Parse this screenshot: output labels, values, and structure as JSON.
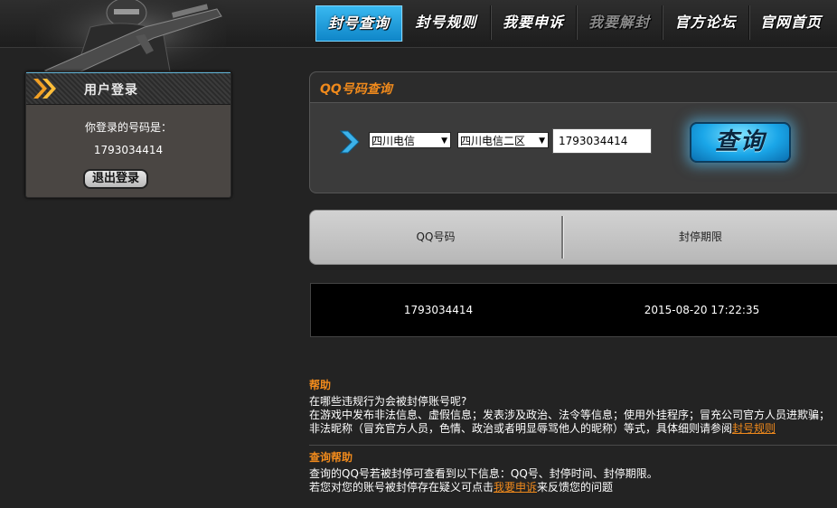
{
  "nav": {
    "items": [
      {
        "label": "封号查询",
        "state": "active"
      },
      {
        "label": "封号规则",
        "state": "normal"
      },
      {
        "label": "我要申诉",
        "state": "normal"
      },
      {
        "label": "我要解封",
        "state": "disabled"
      },
      {
        "label": "官方论坛",
        "state": "normal"
      },
      {
        "label": "官网首页",
        "state": "normal"
      }
    ]
  },
  "login": {
    "title": "用户登录",
    "label": "你登录的号码是：",
    "qq": "1793034414",
    "logout_label": "退出登录"
  },
  "query": {
    "title": "QQ号码查询",
    "isp_select": "四川电信",
    "region_select": "四川电信二区",
    "qq_value": "1793034414",
    "button_label": "查询"
  },
  "results": {
    "columns": [
      "QQ号码",
      "封停期限"
    ],
    "rows": [
      [
        "1793034414",
        "2015-08-20 17:22:35"
      ]
    ]
  },
  "help": {
    "title": "帮助",
    "question": "在哪些违规行为会被封停账号呢?",
    "line1": "在游戏中发布非法信息、虚假信息；发表涉及政治、法令等信息；使用外挂程序；冒充公司官方人员进欺骗；",
    "line2_prefix": "非法昵称（冒充官方人员，色情、政治或者明显辱骂他人的昵称）等式，具体细则请参阅",
    "line2_link": "封号规则"
  },
  "query_help": {
    "title": "查询帮助",
    "line1": "查询的QQ号若被封停可查看到以下信息：QQ号、封停时间、封停期限。",
    "line2_prefix": "若您对您的账号被封停存在疑义可点击",
    "line2_link": "我要申诉",
    "line2_suffix": "来反馈您的问题"
  },
  "colors": {
    "accent_orange": "#f08a1c",
    "accent_blue": "#1aa6e8",
    "background": "#232323"
  }
}
